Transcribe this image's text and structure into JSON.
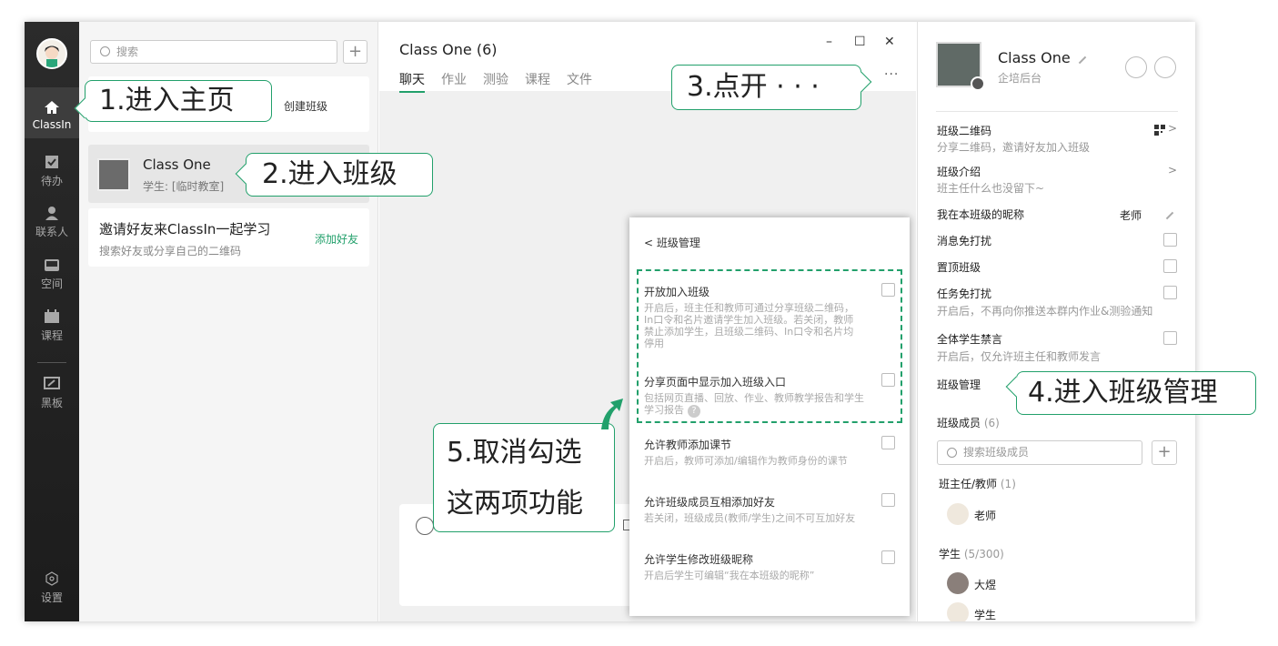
{
  "rail": {
    "items": [
      {
        "label": "ClassIn"
      },
      {
        "label": "待办"
      },
      {
        "label": "联系人"
      },
      {
        "label": "空间"
      },
      {
        "label": "课程"
      },
      {
        "label": "黑板"
      },
      {
        "label": "设置"
      }
    ]
  },
  "list": {
    "search_placeholder": "搜索",
    "create_class": "创建班级",
    "class_item": {
      "name": "Class One",
      "subtitle": "学生: [临时教室]"
    },
    "invite": {
      "title": "邀请好友来ClassIn一起学习",
      "subtitle": "搜索好友或分享自己的二维码",
      "action": "添加好友"
    }
  },
  "main": {
    "title": "Class One (6)",
    "tabs": [
      "聊天",
      "作业",
      "测验",
      "课程",
      "文件"
    ],
    "active_tab": "聊天",
    "window_controls": [
      "–",
      "☐",
      "✕"
    ],
    "more": "···"
  },
  "right": {
    "class_name": "Class One",
    "org": "企培后台",
    "rows": {
      "qr": {
        "label": "班级二维码",
        "desc": "分享二维码，邀请好友加入班级"
      },
      "intro": {
        "label": "班级介绍",
        "desc": "班主任什么也没留下~"
      },
      "nickname": {
        "label": "我在本班级的昵称",
        "value": "老师"
      },
      "dnd": {
        "label": "消息免打扰"
      },
      "pin": {
        "label": "置顶班级"
      },
      "task_dnd": {
        "label": "任务免打扰",
        "desc": "开启后，不再向你推送本群内作业&测验通知"
      },
      "mute_all": {
        "label": "全体学生禁言",
        "desc": "开启后，仅允许班主任和教师发言"
      },
      "manage": {
        "label": "班级管理"
      }
    },
    "members": {
      "label": "班级成员",
      "count": "(6)",
      "search_placeholder": "搜索班级成员",
      "teacher_group": "班主任/教师",
      "teacher_count": "(1)",
      "teacher_name": "老师",
      "student_group": "学生",
      "student_count": "(5/300)",
      "students": [
        "大煜",
        "学生"
      ]
    }
  },
  "popup": {
    "title": "班级管理",
    "items": [
      {
        "title": "开放加入班级",
        "desc": "开启后，班主任和教师可通过分享班级二维码，In口令和名片邀请学生加入班级。若关闭，教师禁止添加学生，且班级二维码、In口令和名片均停用"
      },
      {
        "title": "分享页面中显示加入班级入口",
        "desc": "包括网页直播、回放、作业、教师教学报告和学生学习报告"
      },
      {
        "title": "允许教师添加课节",
        "desc": "开启后，教师可添加/编辑作为教师身份的课节"
      },
      {
        "title": "允许班级成员互相添加好友",
        "desc": "若关闭，班级成员(教师/学生)之间不可互加好友"
      },
      {
        "title": "允许学生修改班级昵称",
        "desc": "开启后学生可编辑“我在本班级的昵称”"
      }
    ]
  },
  "callouts": {
    "step1": "1.进入主页",
    "step2": "2.进入班级",
    "step3": "3.点开 · · ·",
    "step4": "4.进入班级管理",
    "step5_line1": "5.取消勾选",
    "step5_line2": "这两项功能"
  },
  "colors": {
    "accent": "#22a06b",
    "rail": "#222222"
  }
}
